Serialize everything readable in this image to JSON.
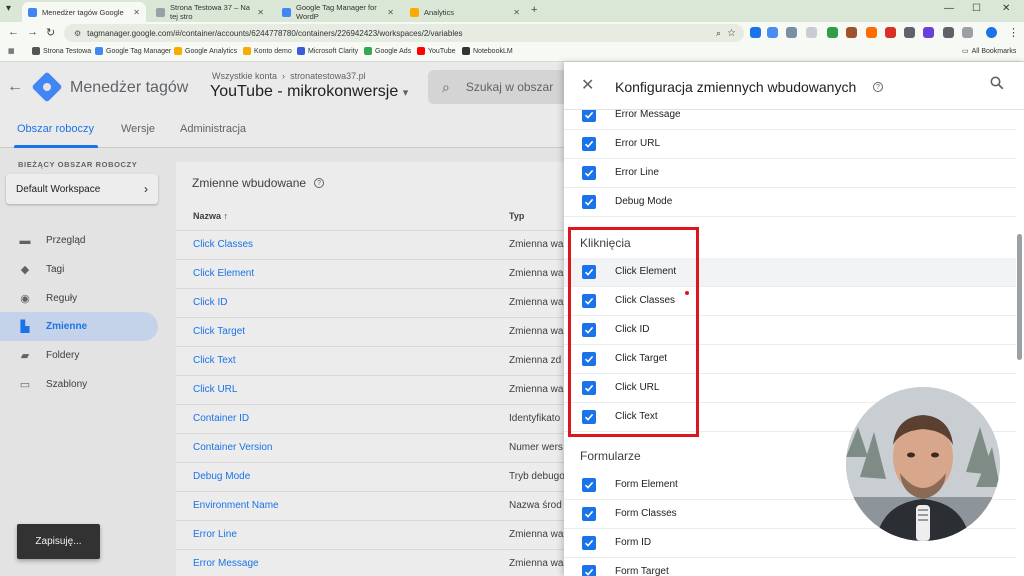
{
  "browser": {
    "tabs": [
      {
        "title": "Menedżer tagów Google",
        "active": true,
        "color": "#4285f4"
      },
      {
        "title": "Strona Testowa 37 – Na tej stro",
        "active": false,
        "color": "#9aa0a6"
      },
      {
        "title": "Google Tag Manager for WordP",
        "active": false,
        "color": "#4285f4"
      },
      {
        "title": "Analytics",
        "active": false,
        "color": "#f9ab00"
      }
    ],
    "new_tab": "+",
    "url": "tagmanager.google.com/#/container/accounts/6244778780/containers/226942423/workspaces/2/variables",
    "bookmarks": [
      {
        "label": "Strona Testowa",
        "color": "#555555"
      },
      {
        "label": "Google Tag Manager",
        "color": "#4285f4"
      },
      {
        "label": "Google Analytics",
        "color": "#f9ab00"
      },
      {
        "label": "Konto demo",
        "color": "#f9ab00"
      },
      {
        "label": "Microsoft Clarity",
        "color": "#3b5bdb"
      },
      {
        "label": "Google Ads",
        "color": "#34a853"
      },
      {
        "label": "YouTube",
        "color": "#ff0000"
      },
      {
        "label": "NotebookLM",
        "color": "#333333"
      }
    ],
    "all_bookmarks": "All Bookmarks"
  },
  "header": {
    "app_title": "Menedżer tagów",
    "account_crumb": "Wszystkie konta",
    "account_name": "stronatestowa37.pl",
    "container_name": "YouTube - mikrokonwersje",
    "search_placeholder": "Szukaj w obszar"
  },
  "subnav": {
    "tabs": [
      "Obszar roboczy",
      "Wersje",
      "Administracja"
    ],
    "active": "Obszar roboczy"
  },
  "sidebar": {
    "workspace_label": "BIEŻĄCY OBSZAR ROBOCZY",
    "workspace_name": "Default Workspace",
    "items": [
      {
        "label": "Przegląd",
        "icon": "overview-icon",
        "active": false
      },
      {
        "label": "Tagi",
        "icon": "tag-icon",
        "active": false
      },
      {
        "label": "Reguły",
        "icon": "trigger-icon",
        "active": false
      },
      {
        "label": "Zmienne",
        "icon": "variables-icon",
        "active": true
      },
      {
        "label": "Foldery",
        "icon": "folder-icon",
        "active": false
      },
      {
        "label": "Szablony",
        "icon": "template-icon",
        "active": false
      }
    ]
  },
  "toast": "Zapisuję...",
  "table": {
    "title": "Zmienne wbudowane",
    "columns": [
      "Nazwa",
      "Typ"
    ],
    "rows": [
      {
        "name": "Click Classes",
        "type": "Zmienna wa"
      },
      {
        "name": "Click Element",
        "type": "Zmienna wa"
      },
      {
        "name": "Click ID",
        "type": "Zmienna wa"
      },
      {
        "name": "Click Target",
        "type": "Zmienna wa"
      },
      {
        "name": "Click Text",
        "type": "Zmienna zd"
      },
      {
        "name": "Click URL",
        "type": "Zmienna wa"
      },
      {
        "name": "Container ID",
        "type": "Identyfikato"
      },
      {
        "name": "Container Version",
        "type": "Numer wers"
      },
      {
        "name": "Debug Mode",
        "type": "Tryb debugo"
      },
      {
        "name": "Environment Name",
        "type": "Nazwa środ"
      },
      {
        "name": "Error Line",
        "type": "Zmienna wa"
      },
      {
        "name": "Error Message",
        "type": "Zmienna wa"
      }
    ]
  },
  "panel": {
    "title": "Konfiguracja zmiennych wbudowanych",
    "errors_items": [
      "Error Message",
      "Error URL",
      "Error Line",
      "Debug Mode"
    ],
    "clicks_heading": "Kliknięcia",
    "clicks_items": [
      "Click Element",
      "Click Classes",
      "Click ID",
      "Click Target",
      "Click URL",
      "Click Text"
    ],
    "forms_heading": "Formularze",
    "forms_items": [
      "Form Element",
      "Form Classes",
      "Form ID",
      "Form Target"
    ]
  },
  "colors": {
    "accent": "#1a73e8",
    "highlight_box": "#e0141e"
  }
}
